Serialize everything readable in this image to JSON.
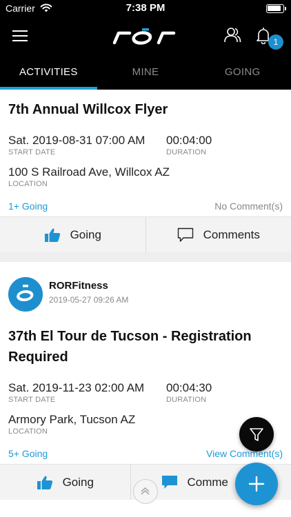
{
  "status": {
    "carrier": "Carrier",
    "time": "7:38 PM"
  },
  "nav": {
    "notification_count": "1"
  },
  "tabs": [
    {
      "label": "ACTIVITIES",
      "active": true
    },
    {
      "label": "MINE",
      "active": false
    },
    {
      "label": "GOING",
      "active": false
    }
  ],
  "activities": [
    {
      "title": "7th Annual Willcox Flyer",
      "start_date": "Sat. 2019-08-31 07:00 AM",
      "start_date_label": "START DATE",
      "duration": "00:04:00",
      "duration_label": "DURATION",
      "location": "100 S Railroad Ave, Willcox AZ",
      "location_label": "LOCATION",
      "going_count": "1+ Going",
      "comment_status": "No Comment(s)",
      "going_button": "Going",
      "comments_button": "Comments"
    },
    {
      "organizer": "RORFitness",
      "posted_at": "2019-05-27 09:26 AM",
      "title_line1": "37th El Tour de Tucson - Registration",
      "title_line2": "Required",
      "start_date": "Sat. 2019-11-23 02:00 AM",
      "start_date_label": "START DATE",
      "duration": "00:04:30",
      "duration_label": "DURATION",
      "location": "Armory Park, Tucson AZ",
      "location_label": "LOCATION",
      "going_count": "5+ Going",
      "comment_status": "View Comment(s)",
      "going_button": "Going",
      "comments_button": "Comme"
    }
  ],
  "colors": {
    "accent": "#1e93d3",
    "header": "#000000"
  },
  "icons": [
    "wifi-icon",
    "battery-icon",
    "menu-icon",
    "ror-logo",
    "user-icon",
    "bell-icon",
    "thumbs-up-icon",
    "comment-icon",
    "filter-icon",
    "plus-icon",
    "chevron-up-icon"
  ]
}
